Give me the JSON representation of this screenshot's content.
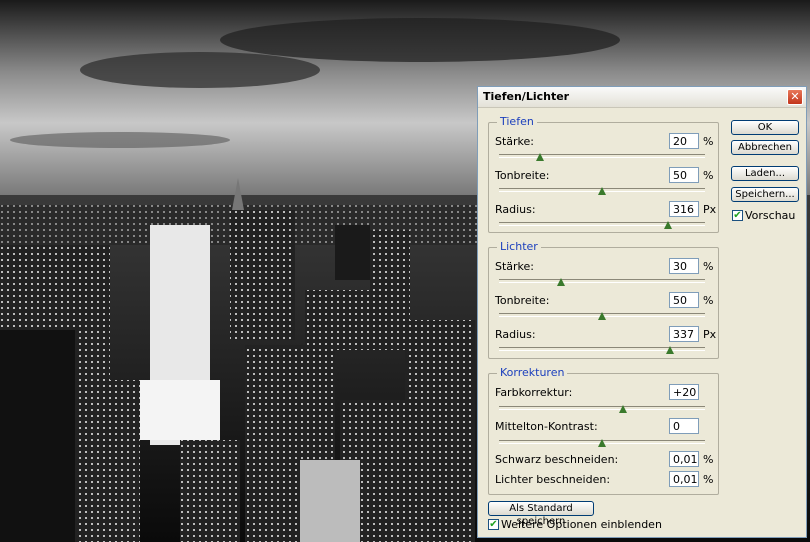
{
  "dialog": {
    "title": "Tiefen/Lichter",
    "close_icon": "close-icon",
    "buttons": {
      "ok": "OK",
      "cancel": "Abbrechen",
      "load": "Laden...",
      "save": "Speichern...",
      "save_default": "Als Standard speichern"
    },
    "preview": {
      "label": "Vorschau",
      "checked": true
    },
    "more_options": {
      "label": "Weitere Optionen einblenden",
      "checked": true
    },
    "tiefen": {
      "title": "Tiefen",
      "staerke": {
        "label": "Stärke:",
        "value": "20",
        "unit": "%",
        "slider": 0.2
      },
      "tonbreite": {
        "label": "Tonbreite:",
        "value": "50",
        "unit": "%",
        "slider": 0.5
      },
      "radius": {
        "label": "Radius:",
        "value": "316",
        "unit": "Px",
        "slider": 0.82
      }
    },
    "lichter": {
      "title": "Lichter",
      "staerke": {
        "label": "Stärke:",
        "value": "30",
        "unit": "%",
        "slider": 0.3
      },
      "tonbreite": {
        "label": "Tonbreite:",
        "value": "50",
        "unit": "%",
        "slider": 0.5
      },
      "radius": {
        "label": "Radius:",
        "value": "337",
        "unit": "Px",
        "slider": 0.83
      }
    },
    "korrekturen": {
      "title": "Korrekturen",
      "farbkorrektur": {
        "label": "Farbkorrektur:",
        "value": "+20",
        "slider": 0.6
      },
      "mittelton": {
        "label": "Mittelton-Kontrast:",
        "value": "0",
        "slider": 0.5
      },
      "schwarz": {
        "label": "Schwarz beschneiden:",
        "value": "0,01",
        "unit": "%"
      },
      "lichter_beschneiden": {
        "label": "Lichter beschneiden:",
        "value": "0,01",
        "unit": "%"
      }
    }
  },
  "colors": {
    "dialog_bg": "#ece9d8",
    "group_title": "#1b3fbd",
    "slider_thumb": "#3a7a2c"
  }
}
